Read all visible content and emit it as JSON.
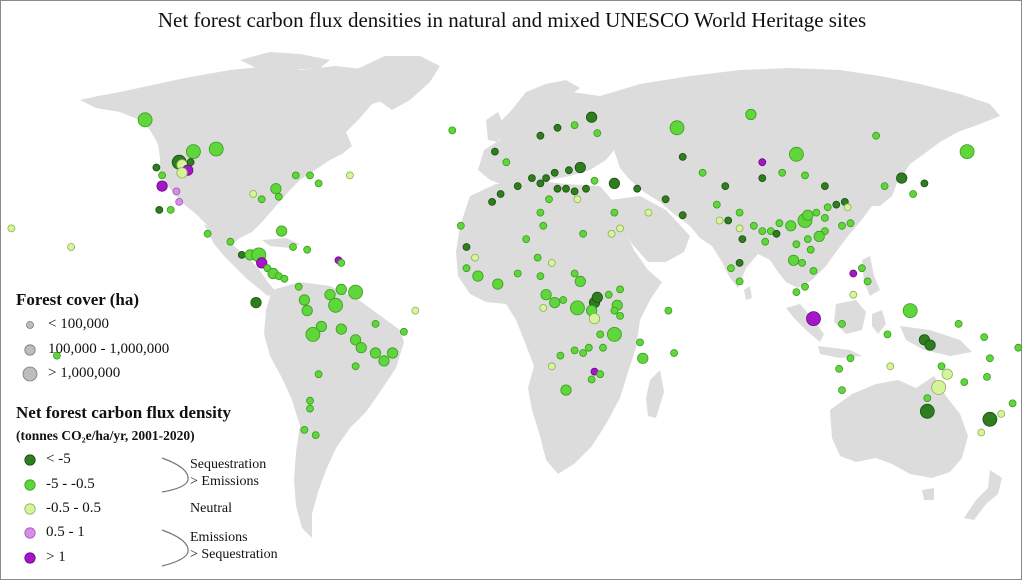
{
  "title": "Net forest carbon flux densities in natural and mixed UNESCO World Heritage sites",
  "legend": {
    "cover_title": "Forest cover (ha)",
    "cover_items": [
      "< 100,000",
      "100,000 - 1,000,000",
      "> 1,000,000"
    ],
    "flux_title": "Net forest carbon flux density",
    "flux_units": "(tonnes CO₂e/ha/yr, 2001-2020)",
    "flux_items": [
      "< -5",
      "-5 - -0.5",
      "-0.5 - 0.5",
      "0.5 - 1",
      "> 1"
    ],
    "group_labels": {
      "seq_line1": "Sequestration",
      "seq_line2": "> Emissions",
      "neutral": "Neutral",
      "emi_line1": "Emissions",
      "emi_line2": "> Sequestration"
    }
  },
  "colors": {
    "land": "#dcdcdc",
    "class_colors": [
      "#2e7d1e",
      "#5fd63a",
      "#d6f59a",
      "#d88ee8",
      "#a416c8"
    ],
    "class_strokes": [
      "#1c4f12",
      "#3c9a22",
      "#8ab05a",
      "#9c5aac",
      "#6a0a82"
    ]
  },
  "sites": [
    {
      "lon": -112,
      "lat": 56,
      "f": 1,
      "s": 3
    },
    {
      "lon": -117,
      "lat": 52,
      "f": 0,
      "s": 3
    },
    {
      "lon": -116,
      "lat": 51,
      "f": 2,
      "s": 2
    },
    {
      "lon": -114,
      "lat": 49,
      "f": 4,
      "s": 2
    },
    {
      "lon": -104,
      "lat": 57,
      "f": 1,
      "s": 3
    },
    {
      "lon": -113,
      "lat": 52,
      "f": 0,
      "s": 1
    },
    {
      "lon": -129,
      "lat": 68,
      "f": 1,
      "s": 3
    },
    {
      "lon": -116,
      "lat": 48,
      "f": 2,
      "s": 2
    },
    {
      "lon": -123,
      "lat": 47,
      "f": 1,
      "s": 1
    },
    {
      "lon": -125,
      "lat": 50,
      "f": 0,
      "s": 1
    },
    {
      "lon": -123,
      "lat": 43,
      "f": 4,
      "s": 2
    },
    {
      "lon": -118,
      "lat": 41,
      "f": 3,
      "s": 1
    },
    {
      "lon": -117,
      "lat": 37,
      "f": 3,
      "s": 1
    },
    {
      "lon": -124,
      "lat": 34,
      "f": 0,
      "s": 1
    },
    {
      "lon": -120,
      "lat": 34,
      "f": 1,
      "s": 1
    },
    {
      "lon": -83,
      "lat": 42,
      "f": 1,
      "s": 2
    },
    {
      "lon": -82,
      "lat": 39,
      "f": 1,
      "s": 1
    },
    {
      "lon": -76,
      "lat": 47,
      "f": 1,
      "s": 1
    },
    {
      "lon": -71,
      "lat": 47,
      "f": 1,
      "s": 1
    },
    {
      "lon": -68,
      "lat": 44,
      "f": 1,
      "s": 1
    },
    {
      "lon": -88,
      "lat": 38,
      "f": 1,
      "s": 1
    },
    {
      "lon": -91,
      "lat": 40,
      "f": 2,
      "s": 1
    },
    {
      "lon": -81,
      "lat": 26,
      "f": 1,
      "s": 2
    },
    {
      "lon": -155,
      "lat": 20,
      "f": 2,
      "s": 1
    },
    {
      "lon": -176,
      "lat": 27,
      "f": 2,
      "s": 1
    },
    {
      "lon": -107,
      "lat": 25,
      "f": 1,
      "s": 1
    },
    {
      "lon": -99,
      "lat": 22,
      "f": 1,
      "s": 1
    },
    {
      "lon": -95,
      "lat": 17,
      "f": 0,
      "s": 1
    },
    {
      "lon": -92,
      "lat": 17,
      "f": 1,
      "s": 2
    },
    {
      "lon": -89,
      "lat": 17,
      "f": 1,
      "s": 3
    },
    {
      "lon": -88,
      "lat": 14,
      "f": 4,
      "s": 2
    },
    {
      "lon": -86,
      "lat": 12,
      "f": 1,
      "s": 1
    },
    {
      "lon": -84,
      "lat": 10,
      "f": 1,
      "s": 2
    },
    {
      "lon": -82,
      "lat": 9,
      "f": 1,
      "s": 1
    },
    {
      "lon": -80,
      "lat": 8,
      "f": 1,
      "s": 1
    },
    {
      "lon": -77,
      "lat": 20,
      "f": 1,
      "s": 1
    },
    {
      "lon": -72,
      "lat": 19,
      "f": 1,
      "s": 1
    },
    {
      "lon": -61,
      "lat": 15,
      "f": 4,
      "s": 1
    },
    {
      "lon": -60,
      "lat": 14,
      "f": 1,
      "s": 1
    },
    {
      "lon": -90,
      "lat": -1,
      "f": 0,
      "s": 2
    },
    {
      "lon": -75,
      "lat": 5,
      "f": 1,
      "s": 1
    },
    {
      "lon": -73,
      "lat": 0,
      "f": 1,
      "s": 2
    },
    {
      "lon": -64,
      "lat": 2,
      "f": 1,
      "s": 2
    },
    {
      "lon": -60,
      "lat": 4,
      "f": 1,
      "s": 2
    },
    {
      "lon": -62,
      "lat": -2,
      "f": 1,
      "s": 3
    },
    {
      "lon": -55,
      "lat": 3,
      "f": 1,
      "s": 3
    },
    {
      "lon": -72,
      "lat": -4,
      "f": 1,
      "s": 2
    },
    {
      "lon": -67,
      "lat": -10,
      "f": 1,
      "s": 2
    },
    {
      "lon": -70,
      "lat": -13,
      "f": 1,
      "s": 3
    },
    {
      "lon": -60,
      "lat": -11,
      "f": 1,
      "s": 2
    },
    {
      "lon": -48,
      "lat": -9,
      "f": 1,
      "s": 1
    },
    {
      "lon": -38,
      "lat": -12,
      "f": 1,
      "s": 1
    },
    {
      "lon": -55,
      "lat": -15,
      "f": 1,
      "s": 2
    },
    {
      "lon": -53,
      "lat": -18,
      "f": 1,
      "s": 2
    },
    {
      "lon": -48,
      "lat": -20,
      "f": 1,
      "s": 2
    },
    {
      "lon": -45,
      "lat": -23,
      "f": 1,
      "s": 2
    },
    {
      "lon": -42,
      "lat": -20,
      "f": 1,
      "s": 2
    },
    {
      "lon": -55,
      "lat": -25,
      "f": 1,
      "s": 1
    },
    {
      "lon": -68,
      "lat": -28,
      "f": 1,
      "s": 1
    },
    {
      "lon": -71,
      "lat": -38,
      "f": 1,
      "s": 1
    },
    {
      "lon": -71,
      "lat": -41,
      "f": 1,
      "s": 1
    },
    {
      "lon": -73,
      "lat": -49,
      "f": 1,
      "s": 1
    },
    {
      "lon": -69,
      "lat": -51,
      "f": 1,
      "s": 1
    },
    {
      "lon": -34,
      "lat": -4,
      "f": 2,
      "s": 1
    },
    {
      "lon": -21,
      "lat": 64,
      "f": 1,
      "s": 1
    },
    {
      "lon": -6,
      "lat": 56,
      "f": 0,
      "s": 1
    },
    {
      "lon": -2,
      "lat": 52,
      "f": 1,
      "s": 1
    },
    {
      "lon": 7,
      "lat": 46,
      "f": 0,
      "s": 1
    },
    {
      "lon": 12,
      "lat": 46,
      "f": 0,
      "s": 1
    },
    {
      "lon": 15,
      "lat": 48,
      "f": 0,
      "s": 1
    },
    {
      "lon": 20,
      "lat": 49,
      "f": 0,
      "s": 1
    },
    {
      "lon": 24,
      "lat": 50,
      "f": 0,
      "s": 2
    },
    {
      "lon": 2,
      "lat": 43,
      "f": 0,
      "s": 1
    },
    {
      "lon": -4,
      "lat": 40,
      "f": 0,
      "s": 1
    },
    {
      "lon": -7,
      "lat": 37,
      "f": 0,
      "s": 1
    },
    {
      "lon": 10,
      "lat": 44,
      "f": 0,
      "s": 1
    },
    {
      "lon": 16,
      "lat": 42,
      "f": 0,
      "s": 1
    },
    {
      "lon": 19,
      "lat": 42,
      "f": 0,
      "s": 1
    },
    {
      "lon": 22,
      "lat": 41,
      "f": 0,
      "s": 1
    },
    {
      "lon": 26,
      "lat": 42,
      "f": 0,
      "s": 1
    },
    {
      "lon": 29,
      "lat": 45,
      "f": 1,
      "s": 1
    },
    {
      "lon": 13,
      "lat": 38,
      "f": 1,
      "s": 1
    },
    {
      "lon": 23,
      "lat": 38,
      "f": 2,
      "s": 1
    },
    {
      "lon": 36,
      "lat": 44,
      "f": 0,
      "s": 2
    },
    {
      "lon": 44,
      "lat": 42,
      "f": 0,
      "s": 1
    },
    {
      "lon": 10,
      "lat": 62,
      "f": 0,
      "s": 1
    },
    {
      "lon": 16,
      "lat": 65,
      "f": 0,
      "s": 1
    },
    {
      "lon": 22,
      "lat": 66,
      "f": 1,
      "s": 1
    },
    {
      "lon": 28,
      "lat": 69,
      "f": 0,
      "s": 2
    },
    {
      "lon": 30,
      "lat": 63,
      "f": 1,
      "s": 1
    },
    {
      "lon": 58,
      "lat": 65,
      "f": 1,
      "s": 3
    },
    {
      "lon": 84,
      "lat": 70,
      "f": 1,
      "s": 2
    },
    {
      "lon": 60,
      "lat": 54,
      "f": 0,
      "s": 1
    },
    {
      "lon": 88,
      "lat": 52,
      "f": 4,
      "s": 1
    },
    {
      "lon": 100,
      "lat": 55,
      "f": 1,
      "s": 3
    },
    {
      "lon": 128,
      "lat": 62,
      "f": 1,
      "s": 1
    },
    {
      "lon": 160,
      "lat": 56,
      "f": 1,
      "s": 3
    },
    {
      "lon": 137,
      "lat": 46,
      "f": 0,
      "s": 2
    },
    {
      "lon": 145,
      "lat": 44,
      "f": 0,
      "s": 1
    },
    {
      "lon": 141,
      "lat": 40,
      "f": 1,
      "s": 1
    },
    {
      "lon": 131,
      "lat": 43,
      "f": 1,
      "s": 1
    },
    {
      "lon": 67,
      "lat": 48,
      "f": 1,
      "s": 1
    },
    {
      "lon": 75,
      "lat": 43,
      "f": 0,
      "s": 1
    },
    {
      "lon": 88,
      "lat": 46,
      "f": 0,
      "s": 1
    },
    {
      "lon": 95,
      "lat": 48,
      "f": 1,
      "s": 1
    },
    {
      "lon": 103,
      "lat": 47,
      "f": 1,
      "s": 1
    },
    {
      "lon": 110,
      "lat": 43,
      "f": 0,
      "s": 1
    },
    {
      "lon": 72,
      "lat": 36,
      "f": 1,
      "s": 1
    },
    {
      "lon": 80,
      "lat": 33,
      "f": 1,
      "s": 1
    },
    {
      "lon": 85,
      "lat": 28,
      "f": 1,
      "s": 1
    },
    {
      "lon": 88,
      "lat": 26,
      "f": 1,
      "s": 1
    },
    {
      "lon": 91,
      "lat": 26,
      "f": 1,
      "s": 1
    },
    {
      "lon": 80,
      "lat": 27,
      "f": 2,
      "s": 1
    },
    {
      "lon": 76,
      "lat": 30,
      "f": 0,
      "s": 1
    },
    {
      "lon": 94,
      "lat": 29,
      "f": 1,
      "s": 1
    },
    {
      "lon": 98,
      "lat": 28,
      "f": 1,
      "s": 2
    },
    {
      "lon": 103,
      "lat": 30,
      "f": 1,
      "s": 3
    },
    {
      "lon": 104,
      "lat": 32,
      "f": 1,
      "s": 2
    },
    {
      "lon": 107,
      "lat": 33,
      "f": 1,
      "s": 1
    },
    {
      "lon": 110,
      "lat": 31,
      "f": 1,
      "s": 1
    },
    {
      "lon": 111,
      "lat": 35,
      "f": 1,
      "s": 1
    },
    {
      "lon": 114,
      "lat": 36,
      "f": 0,
      "s": 1
    },
    {
      "lon": 117,
      "lat": 37,
      "f": 0,
      "s": 1
    },
    {
      "lon": 118,
      "lat": 35,
      "f": 2,
      "s": 1
    },
    {
      "lon": 119,
      "lat": 29,
      "f": 1,
      "s": 1
    },
    {
      "lon": 116,
      "lat": 28,
      "f": 1,
      "s": 1
    },
    {
      "lon": 110,
      "lat": 26,
      "f": 1,
      "s": 1
    },
    {
      "lon": 108,
      "lat": 24,
      "f": 1,
      "s": 2
    },
    {
      "lon": 104,
      "lat": 23,
      "f": 1,
      "s": 1
    },
    {
      "lon": 100,
      "lat": 21,
      "f": 1,
      "s": 1
    },
    {
      "lon": 105,
      "lat": 19,
      "f": 1,
      "s": 1
    },
    {
      "lon": 102,
      "lat": 14,
      "f": 1,
      "s": 1
    },
    {
      "lon": 99,
      "lat": 15,
      "f": 1,
      "s": 2
    },
    {
      "lon": 106,
      "lat": 11,
      "f": 1,
      "s": 1
    },
    {
      "lon": 103,
      "lat": 5,
      "f": 1,
      "s": 1
    },
    {
      "lon": 100,
      "lat": 3,
      "f": 1,
      "s": 1
    },
    {
      "lon": 106,
      "lat": -7,
      "f": 4,
      "s": 3
    },
    {
      "lon": 116,
      "lat": -9,
      "f": 1,
      "s": 1
    },
    {
      "lon": 120,
      "lat": 2,
      "f": 2,
      "s": 1
    },
    {
      "lon": 120,
      "lat": 10,
      "f": 4,
      "s": 1
    },
    {
      "lon": 123,
      "lat": 12,
      "f": 1,
      "s": 1
    },
    {
      "lon": 125,
      "lat": 7,
      "f": 1,
      "s": 1
    },
    {
      "lon": 140,
      "lat": -4,
      "f": 1,
      "s": 3
    },
    {
      "lon": 157,
      "lat": -9,
      "f": 1,
      "s": 1
    },
    {
      "lon": 166,
      "lat": -14,
      "f": 1,
      "s": 1
    },
    {
      "lon": 168,
      "lat": -22,
      "f": 1,
      "s": 1
    },
    {
      "lon": 77,
      "lat": 12,
      "f": 1,
      "s": 1
    },
    {
      "lon": 80,
      "lat": 7,
      "f": 1,
      "s": 1
    },
    {
      "lon": 81,
      "lat": 23,
      "f": 0,
      "s": 1
    },
    {
      "lon": 89,
      "lat": 22,
      "f": 1,
      "s": 1
    },
    {
      "lon": 93,
      "lat": 25,
      "f": 0,
      "s": 1
    },
    {
      "lon": 80,
      "lat": 14,
      "f": 0,
      "s": 1
    },
    {
      "lon": 73,
      "lat": 30,
      "f": 2,
      "s": 1
    },
    {
      "lon": 60,
      "lat": 32,
      "f": 0,
      "s": 1
    },
    {
      "lon": 48,
      "lat": 33,
      "f": 2,
      "s": 1
    },
    {
      "lon": 54,
      "lat": 38,
      "f": 0,
      "s": 1
    },
    {
      "lon": 36,
      "lat": 33,
      "f": 1,
      "s": 1
    },
    {
      "lon": 38,
      "lat": 27,
      "f": 2,
      "s": 1
    },
    {
      "lon": -18,
      "lat": 28,
      "f": 1,
      "s": 1
    },
    {
      "lon": -16,
      "lat": 20,
      "f": 0,
      "s": 1
    },
    {
      "lon": 10,
      "lat": 33,
      "f": 1,
      "s": 1
    },
    {
      "lon": 11,
      "lat": 28,
      "f": 1,
      "s": 1
    },
    {
      "lon": 5,
      "lat": 23,
      "f": 1,
      "s": 1
    },
    {
      "lon": 25,
      "lat": 25,
      "f": 1,
      "s": 1
    },
    {
      "lon": 35,
      "lat": 25,
      "f": 2,
      "s": 1
    },
    {
      "lon": -13,
      "lat": 16,
      "f": 2,
      "s": 1
    },
    {
      "lon": -16,
      "lat": 12,
      "f": 1,
      "s": 1
    },
    {
      "lon": -12,
      "lat": 9,
      "f": 1,
      "s": 2
    },
    {
      "lon": -5,
      "lat": 6,
      "f": 1,
      "s": 2
    },
    {
      "lon": 2,
      "lat": 10,
      "f": 1,
      "s": 1
    },
    {
      "lon": 10,
      "lat": 9,
      "f": 1,
      "s": 1
    },
    {
      "lon": 9,
      "lat": 16,
      "f": 1,
      "s": 1
    },
    {
      "lon": 14,
      "lat": 14,
      "f": 2,
      "s": 1
    },
    {
      "lon": 22,
      "lat": 10,
      "f": 1,
      "s": 1
    },
    {
      "lon": 24,
      "lat": 7,
      "f": 1,
      "s": 2
    },
    {
      "lon": 12,
      "lat": 2,
      "f": 1,
      "s": 2
    },
    {
      "lon": 15,
      "lat": -1,
      "f": 1,
      "s": 2
    },
    {
      "lon": 11,
      "lat": -3,
      "f": 2,
      "s": 1
    },
    {
      "lon": 18,
      "lat": 0,
      "f": 1,
      "s": 1
    },
    {
      "lon": 23,
      "lat": -3,
      "f": 1,
      "s": 3
    },
    {
      "lon": 29,
      "lat": -1,
      "f": 0,
      "s": 2
    },
    {
      "lon": 30,
      "lat": 1,
      "f": 0,
      "s": 2
    },
    {
      "lon": 28,
      "lat": -4,
      "f": 1,
      "s": 2
    },
    {
      "lon": 29,
      "lat": -7,
      "f": 2,
      "s": 2
    },
    {
      "lon": 37,
      "lat": -2,
      "f": 1,
      "s": 2
    },
    {
      "lon": 36,
      "lat": -4,
      "f": 1,
      "s": 1
    },
    {
      "lon": 38,
      "lat": -6,
      "f": 1,
      "s": 1
    },
    {
      "lon": 34,
      "lat": 2,
      "f": 1,
      "s": 1
    },
    {
      "lon": 38,
      "lat": 4,
      "f": 1,
      "s": 1
    },
    {
      "lon": 36,
      "lat": -13,
      "f": 1,
      "s": 3
    },
    {
      "lon": 31,
      "lat": -13,
      "f": 1,
      "s": 1
    },
    {
      "lon": 27,
      "lat": -18,
      "f": 1,
      "s": 1
    },
    {
      "lon": 32,
      "lat": -18,
      "f": 1,
      "s": 1
    },
    {
      "lon": 25,
      "lat": -20,
      "f": 1,
      "s": 1
    },
    {
      "lon": 22,
      "lat": -19,
      "f": 1,
      "s": 1
    },
    {
      "lon": 17,
      "lat": -21,
      "f": 1,
      "s": 1
    },
    {
      "lon": 14,
      "lat": -25,
      "f": 2,
      "s": 1
    },
    {
      "lon": 29,
      "lat": -27,
      "f": 4,
      "s": 1
    },
    {
      "lon": 31,
      "lat": -28,
      "f": 1,
      "s": 1
    },
    {
      "lon": 28,
      "lat": -30,
      "f": 1,
      "s": 1
    },
    {
      "lon": 19,
      "lat": -34,
      "f": 1,
      "s": 2
    },
    {
      "lon": 45,
      "lat": -16,
      "f": 1,
      "s": 1
    },
    {
      "lon": 46,
      "lat": -22,
      "f": 1,
      "s": 2
    },
    {
      "lon": 55,
      "lat": -4,
      "f": 1,
      "s": 1
    },
    {
      "lon": 57,
      "lat": -20,
      "f": 1,
      "s": 1
    },
    {
      "lon": -57,
      "lat": 47,
      "f": 2,
      "s": 1
    },
    {
      "lon": 145,
      "lat": -15,
      "f": 0,
      "s": 2
    },
    {
      "lon": 147,
      "lat": -17,
      "f": 0,
      "s": 2
    },
    {
      "lon": 153,
      "lat": -28,
      "f": 2,
      "s": 2
    },
    {
      "lon": 151,
      "lat": -25,
      "f": 1,
      "s": 1
    },
    {
      "lon": 150,
      "lat": -33,
      "f": 2,
      "s": 3
    },
    {
      "lon": 146,
      "lat": -37,
      "f": 1,
      "s": 1
    },
    {
      "lon": 133,
      "lat": -25,
      "f": 2,
      "s": 1
    },
    {
      "lon": 119,
      "lat": -22,
      "f": 1,
      "s": 1
    },
    {
      "lon": 115,
      "lat": -26,
      "f": 1,
      "s": 1
    },
    {
      "lon": 116,
      "lat": -34,
      "f": 1,
      "s": 1
    },
    {
      "lon": 132,
      "lat": -13,
      "f": 1,
      "s": 1
    },
    {
      "lon": 146,
      "lat": -42,
      "f": 0,
      "s": 3
    },
    {
      "lon": 159,
      "lat": -31,
      "f": 1,
      "s": 1
    },
    {
      "lon": 168,
      "lat": -45,
      "f": 0,
      "s": 3
    },
    {
      "lon": 176,
      "lat": -39,
      "f": 1,
      "s": 1
    },
    {
      "lon": 167,
      "lat": -29,
      "f": 1,
      "s": 1
    },
    {
      "lon": 172,
      "lat": -43,
      "f": 2,
      "s": 1
    },
    {
      "lon": 165,
      "lat": -50,
      "f": 2,
      "s": 1
    },
    {
      "lon": 178,
      "lat": -18,
      "f": 1,
      "s": 1
    },
    {
      "lon": -160,
      "lat": -21,
      "f": 1,
      "s": 1
    }
  ]
}
